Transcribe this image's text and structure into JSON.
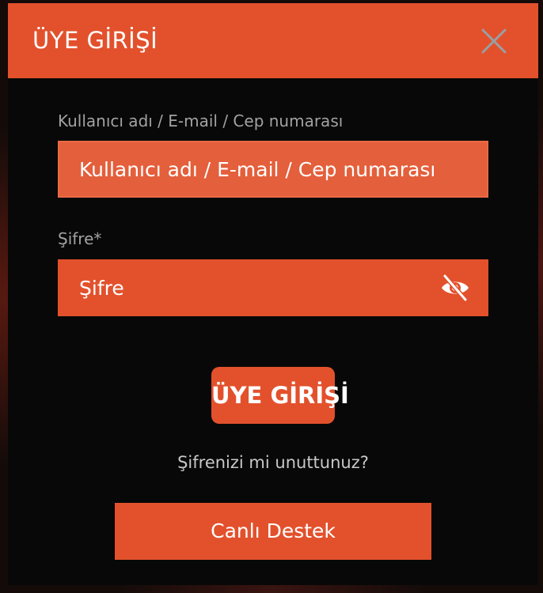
{
  "modal": {
    "title": "ÜYE GİRİŞİ",
    "close_icon": "close-icon"
  },
  "form": {
    "username": {
      "label": "Kullanıcı adı / E-mail / Cep numarası",
      "placeholder": "Kullanıcı adı / E-mail / Cep numarası",
      "value": ""
    },
    "password": {
      "label": "Şifre*",
      "placeholder": "Şifre",
      "value": "",
      "toggle_icon": "eye-slash-icon"
    },
    "submit_label": "ÜYE GİRİŞİ",
    "forgot_label": "Şifrenizi mi unuttunuz?",
    "support_label": "Canlı Destek"
  },
  "colors": {
    "accent": "#e2512c",
    "modal_bg": "#080808",
    "label": "#a2a2a2"
  }
}
